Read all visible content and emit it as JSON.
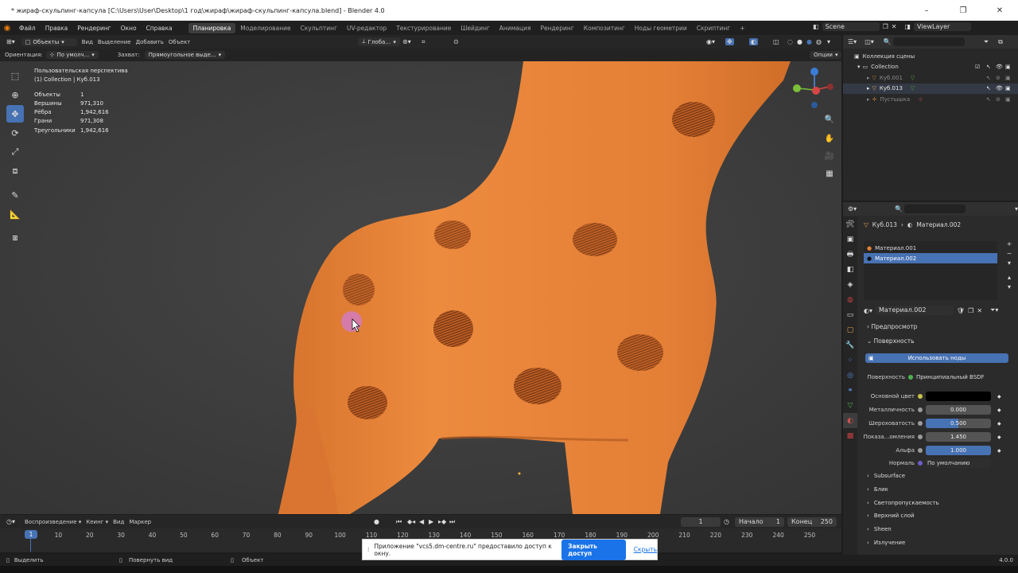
{
  "window": {
    "title": "* жираф-скульпинг-капсула [C:\\Users\\User\\Desktop\\1 год\\жираф\\жираф-скульпинг-капсула.blend] - Blender 4.0",
    "controls": [
      "–",
      "❐",
      "✕"
    ]
  },
  "menu": [
    "Файл",
    "Правка",
    "Рендеринг",
    "Окно",
    "Справка"
  ],
  "workspaces": [
    {
      "label": "Планировка",
      "active": true
    },
    {
      "label": "Моделирование"
    },
    {
      "label": "Скульптинг"
    },
    {
      "label": "UV-редактор"
    },
    {
      "label": "Текстурирование"
    },
    {
      "label": "Шейдинг"
    },
    {
      "label": "Анимация"
    },
    {
      "label": "Рендеринг"
    },
    {
      "label": "Композитинг"
    },
    {
      "label": "Ноды геометрии"
    },
    {
      "label": "Скриптинг"
    }
  ],
  "add_workspace": "+",
  "scene": {
    "name": "Scene",
    "view_layer": "ViewLayer"
  },
  "viewport_header": {
    "mode": "Объекты",
    "menus": [
      "Вид",
      "Выделение",
      "Добавить",
      "Объект"
    ],
    "transform_orientation": "Глоба…"
  },
  "tool_settings": {
    "orientation_label": "Ориентация:",
    "orientation_value": "По умолч...",
    "snap_label": "Захват:",
    "snap_value": "Прямоугольное выде...",
    "options": "Опции"
  },
  "overlay": {
    "view_name": "Пользовательская перспектива",
    "collection": "(1) Collection | Куб.013",
    "stats": [
      {
        "k": "Объекты",
        "v": "1"
      },
      {
        "k": "Вершины",
        "v": "971,310"
      },
      {
        "k": "Рёбра",
        "v": "1,942,616"
      },
      {
        "k": "Грани",
        "v": "971,308"
      },
      {
        "k": "Треугольники",
        "v": "1,942,616"
      }
    ]
  },
  "outliner": {
    "root": "Коллекция сцены",
    "collection": "Collection",
    "items": [
      "Куб.001",
      "Куб.013",
      "Пустышка"
    ]
  },
  "properties": {
    "breadcrumb_object": "Куб.013",
    "breadcrumb_material": "Материал.002",
    "slots": [
      "Материал.001",
      "Материал.002"
    ],
    "material_name": "Материал.002",
    "sections": {
      "preview": "Предпросмотр",
      "surface": "Поверхность"
    },
    "use_nodes": "Использовать ноды",
    "surface_label": "Поверхность",
    "surface_value": "Принципиальный BSDF",
    "base_color_label": "Основной цвет",
    "base_color": "#000000",
    "fields": [
      {
        "label": "Металличность",
        "value": "0.000",
        "fraction": 0.0
      },
      {
        "label": "Шероховатость",
        "value": "0.500",
        "fraction": 0.5
      },
      {
        "label": "Показа...омления",
        "value": "1.450",
        "fraction": 0.0
      },
      {
        "label": "Альфа",
        "value": "1.000",
        "fraction": 1.0
      }
    ],
    "normal_label": "Нормаль",
    "normal_value": "По умолчанию",
    "subpanels": [
      "Subsurface",
      "Блик",
      "Светопропускаемость",
      "Верхний слой",
      "Sheen",
      "Излучение"
    ]
  },
  "timeline": {
    "menus": [
      "Воспроизведение",
      "Кеинг",
      "Вид",
      "Маркер"
    ],
    "current_frame": "1",
    "start_label": "Начало",
    "start": "1",
    "end_label": "Конец",
    "end": "250",
    "ticks": [
      "1",
      "10",
      "20",
      "30",
      "40",
      "50",
      "60",
      "70",
      "80",
      "90",
      "100",
      "110",
      "120",
      "130",
      "140",
      "150",
      "160",
      "170",
      "180",
      "190",
      "200",
      "210",
      "220",
      "230",
      "240",
      "250"
    ]
  },
  "statusbar": {
    "select": "Выделить",
    "rotate": "Повернуть вид",
    "object": "Объект",
    "version": "4.0.0"
  },
  "share_notice": {
    "text": "Приложение \"vcs5.dm-centre.ru\" предоставило доступ к окну.",
    "button": "Закрыть доступ",
    "hide": "Скрыть"
  },
  "colors": {
    "accent": "#4772b3",
    "giraffe": "#e27f36",
    "viewport_bg": "#3d3d3d"
  }
}
